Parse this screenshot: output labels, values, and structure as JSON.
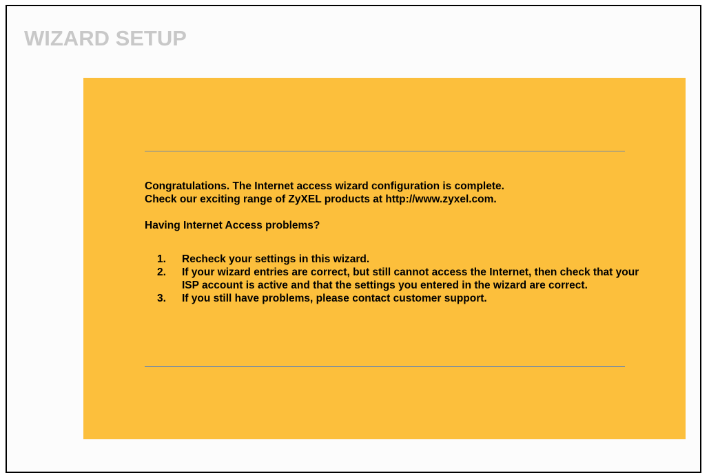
{
  "header": {
    "title": "WIZARD SETUP"
  },
  "main": {
    "congrats_line1": "Congratulations. The Internet access wizard configuration is complete.",
    "congrats_line2": "Check our exciting range of ZyXEL products at http://www.zyxel.com.",
    "problems_heading": "Having Internet Access problems?",
    "steps": [
      {
        "number": "1.",
        "text": "Recheck your settings in this wizard."
      },
      {
        "number": "2.",
        "text": "If your wizard entries are correct, but still cannot access the Internet, then check that your ISP account is active and that the settings you entered in the wizard are correct."
      },
      {
        "number": "3.",
        "text": "If you still have problems, please contact customer support."
      }
    ]
  },
  "colors": {
    "panel_background": "#fcbf3c",
    "title_color": "#c8c8c8",
    "rule_color": "#6f89a8"
  }
}
